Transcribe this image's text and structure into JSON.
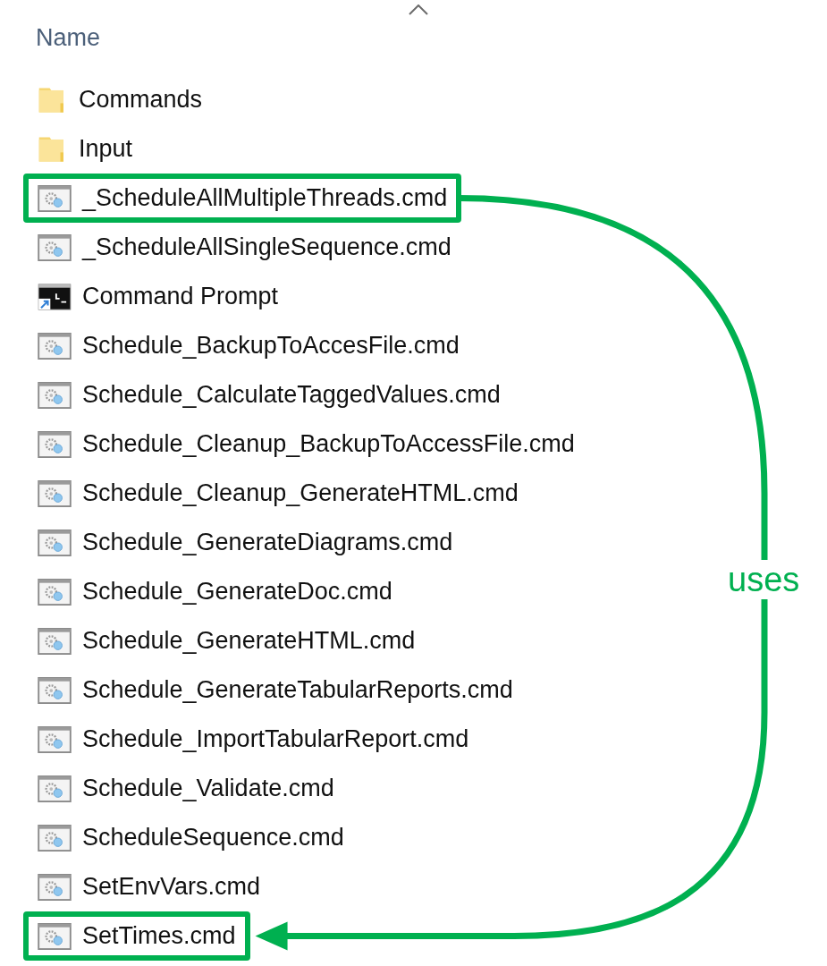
{
  "column_header": {
    "label": "Name",
    "sort_ascending": true
  },
  "files": [
    {
      "kind": "folder",
      "name": "Commands",
      "highlighted": false
    },
    {
      "kind": "folder",
      "name": "Input",
      "highlighted": false
    },
    {
      "kind": "script",
      "name": "_ScheduleAllMultipleThreads.cmd",
      "highlighted": true
    },
    {
      "kind": "script",
      "name": "_ScheduleAllSingleSequence.cmd",
      "highlighted": false
    },
    {
      "kind": "shortcut",
      "name": "Command Prompt",
      "highlighted": false
    },
    {
      "kind": "script",
      "name": "Schedule_BackupToAccesFile.cmd",
      "highlighted": false
    },
    {
      "kind": "script",
      "name": "Schedule_CalculateTaggedValues.cmd",
      "highlighted": false
    },
    {
      "kind": "script",
      "name": "Schedule_Cleanup_BackupToAccessFile.cmd",
      "highlighted": false
    },
    {
      "kind": "script",
      "name": "Schedule_Cleanup_GenerateHTML.cmd",
      "highlighted": false
    },
    {
      "kind": "script",
      "name": "Schedule_GenerateDiagrams.cmd",
      "highlighted": false
    },
    {
      "kind": "script",
      "name": "Schedule_GenerateDoc.cmd",
      "highlighted": false
    },
    {
      "kind": "script",
      "name": "Schedule_GenerateHTML.cmd",
      "highlighted": false
    },
    {
      "kind": "script",
      "name": "Schedule_GenerateTabularReports.cmd",
      "highlighted": false
    },
    {
      "kind": "script",
      "name": "Schedule_ImportTabularReport.cmd",
      "highlighted": false
    },
    {
      "kind": "script",
      "name": "Schedule_Validate.cmd",
      "highlighted": false
    },
    {
      "kind": "script",
      "name": "ScheduleSequence.cmd",
      "highlighted": false
    },
    {
      "kind": "script",
      "name": "SetEnvVars.cmd",
      "highlighted": false
    },
    {
      "kind": "script",
      "name": "SetTimes.cmd",
      "highlighted": true
    }
  ],
  "annotation": {
    "label": "uses"
  }
}
